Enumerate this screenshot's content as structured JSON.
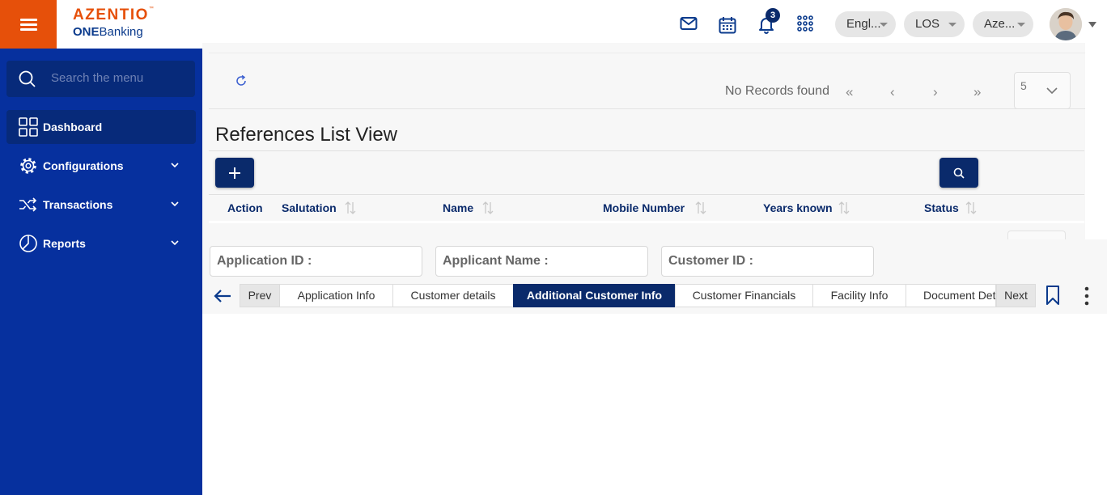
{
  "brand": {
    "name": "AZENTIO",
    "tm": "™",
    "sub_bold": "ONE",
    "sub_rest": "Banking"
  },
  "header": {
    "notification_count": "3",
    "language": "Engl...",
    "module": "LOS",
    "entity": "Aze..."
  },
  "sidebar": {
    "search_placeholder": "Search the menu",
    "items": [
      {
        "label": "Dashboard",
        "icon": "dashboard-grid-icon"
      },
      {
        "label": "Configurations",
        "icon": "gear-icon"
      },
      {
        "label": "Transactions",
        "icon": "shuffle-icon"
      },
      {
        "label": "Reports",
        "icon": "pie-chart-icon"
      }
    ]
  },
  "pager": {
    "status": "No Records found",
    "page_size": "5"
  },
  "references": {
    "title": "References List View",
    "columns": [
      "Action",
      "Salutation",
      "Name",
      "Mobile Number",
      "Years known",
      "Status"
    ]
  },
  "info": {
    "application_id_label": "Application ID :",
    "applicant_name_label": "Applicant Name :",
    "customer_id_label": "Customer ID :"
  },
  "tabs": {
    "prev": "Prev",
    "next": "Next",
    "items": [
      "Application Info",
      "Customer details",
      "Additional Customer Info",
      "Customer Financials",
      "Facility Info",
      "Document Details"
    ],
    "active": "Additional Customer Info"
  }
}
